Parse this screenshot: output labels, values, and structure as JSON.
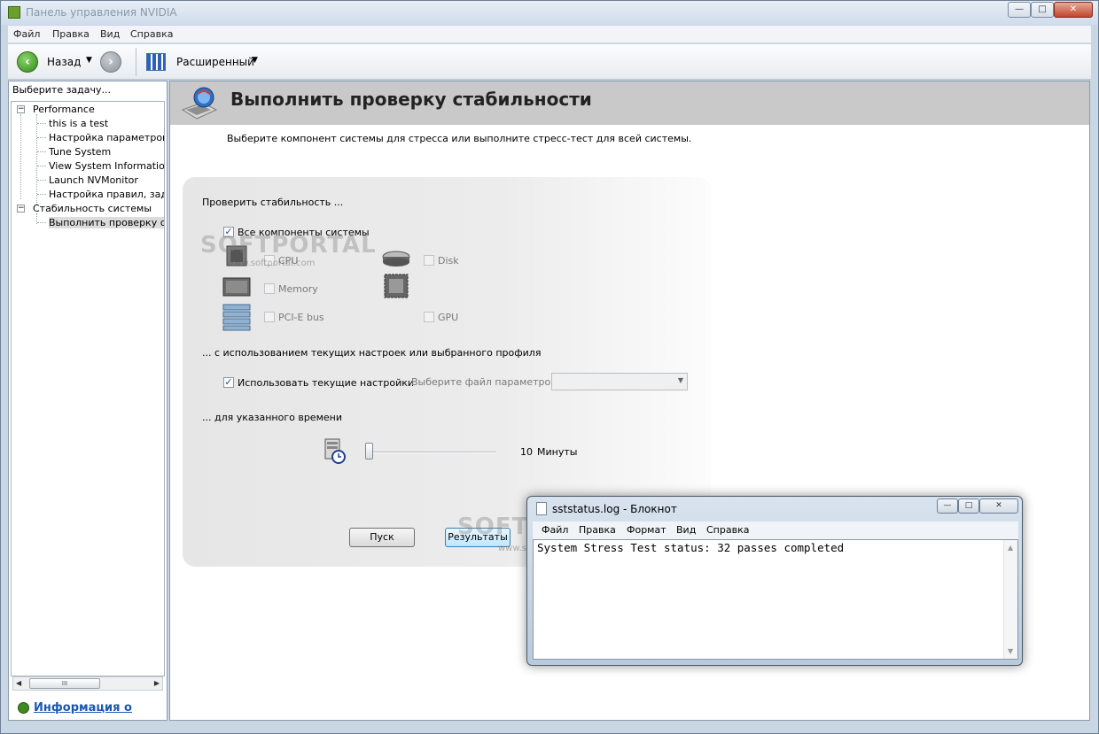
{
  "window": {
    "title": "Панель управления NVIDIA",
    "buttons": {
      "minimize": "—",
      "maximize": "□",
      "close": "✕"
    }
  },
  "menu": [
    "Файл",
    "Правка",
    "Вид",
    "Справка"
  ],
  "toolbar": {
    "back_label": "Назад",
    "view_label": "Расширенный"
  },
  "sidebar": {
    "header": "Выберите задачу...",
    "tree": [
      {
        "label": "Performance",
        "expander": "−"
      },
      {
        "label": "this is a test"
      },
      {
        "label": "Настройка параметров ГП"
      },
      {
        "label": "Tune System"
      },
      {
        "label": "View System Information"
      },
      {
        "label": "Launch NVMonitor"
      },
      {
        "label": "Настройка правил, задан"
      },
      {
        "label": "Стабильность системы",
        "expander": "−"
      },
      {
        "label": "Выполнить проверку стаб"
      }
    ],
    "info_link": "Информация о",
    "scroll_thumb": "III"
  },
  "page": {
    "title": "Выполнить проверку стабильности",
    "description": "Выберите компонент системы для стресса или выполните стресс-тест для всей системы.",
    "check_header": "Проверить стабильность ...",
    "all_components": {
      "label": "Все компоненты системы",
      "checked": "✓"
    },
    "components": {
      "cpu": "CPU",
      "disk": "Disk",
      "memory": "Memory",
      "pcie": "PCI-E bus",
      "gpu": "GPU"
    },
    "profile_header": "... с использованием текущих настроек или выбранного профиля",
    "use_current": {
      "label": "Использовать текущие настройки",
      "checked": "✓"
    },
    "profile_file_label": "Выберите файл параметров:",
    "time_header": "... для указанного времени",
    "duration_value": "10",
    "duration_unit": "Минуты",
    "start_button": "Пуск",
    "results_button": "Результаты"
  },
  "watermark": {
    "big": "SOFTPORTAL",
    "small": "www.softportal.com"
  },
  "notepad": {
    "title": "sststatus.log - Блокнот",
    "menu": [
      "Файл",
      "Правка",
      "Формат",
      "Вид",
      "Справка"
    ],
    "content": "System Stress Test status: 32 passes completed"
  },
  "colors": {
    "accent": "#76b900",
    "header_band": "#c9c9c9",
    "link": "#1a57b3"
  }
}
